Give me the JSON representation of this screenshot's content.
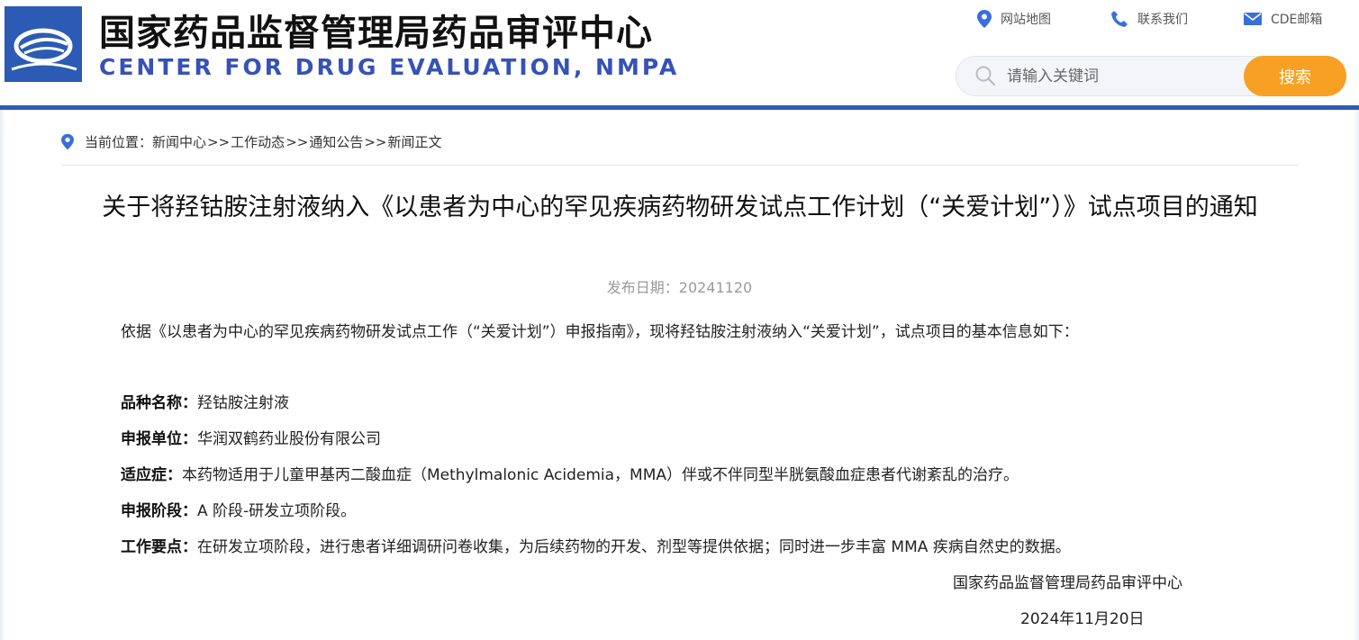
{
  "header": {
    "cn_title": "国家药品监督管理局药品审评中心",
    "en_title": "CENTER FOR DRUG EVALUATION, NMPA",
    "links": [
      {
        "label": "网站地图",
        "icon": "location-pin-icon"
      },
      {
        "label": "联系我们",
        "icon": "phone-icon"
      },
      {
        "label": "CDE邮箱",
        "icon": "mail-icon"
      }
    ],
    "search": {
      "placeholder": "请输入关键词",
      "button_label": "搜索"
    }
  },
  "breadcrumb": {
    "prefix": "当前位置：",
    "items": [
      "新闻中心",
      "工作动态",
      "通知公告",
      "新闻正文"
    ],
    "separator": ">>"
  },
  "article": {
    "title": "关于将羟钴胺注射液纳入《以患者为中心的罕见疾病药物研发试点工作计划（“关爱计划”）》试点项目的通知",
    "date_label": "发布日期：",
    "date_value": "20241120",
    "intro": "依据《以患者为中心的罕见疾病药物研发试点工作（“关爱计划”）申报指南》，现将羟钴胺注射液纳入“关爱计划”，试点项目的基本信息如下：",
    "fields": [
      {
        "label": "品种名称：",
        "value": "羟钴胺注射液"
      },
      {
        "label": "申报单位：",
        "value": "华润双鹤药业股份有限公司"
      },
      {
        "label": "适应症：",
        "value": "本药物适用于儿童甲基丙二酸血症（Methylmalonic Acidemia，MMA）伴或不伴同型半胱氨酸血症患者代谢紊乱的治疗。"
      },
      {
        "label": "申报阶段：",
        "value": "A 阶段-研发立项阶段。"
      },
      {
        "label": "工作要点：",
        "value": "在研发立项阶段，进行患者详细调研问卷收集，为后续药物的开发、剂型等提供依据；同时进一步丰富 MMA 疾病自然史的数据。"
      }
    ],
    "signature_org": "国家药品监督管理局药品审评中心",
    "signature_date": "2024年11月20日"
  },
  "colors": {
    "brand_blue": "#2f5bb3",
    "en_title": "#3651b8",
    "search_button": "#f7a023",
    "link_icon": "#3a6fd8"
  }
}
